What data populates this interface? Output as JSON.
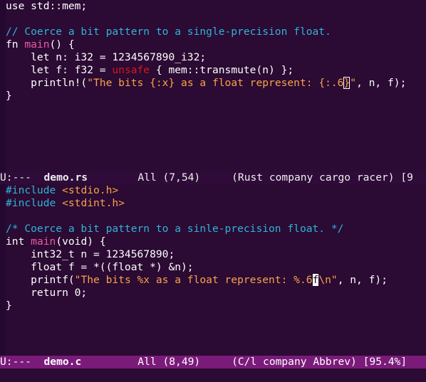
{
  "top_pane": {
    "lines": [
      [
        "use std::mem;"
      ],
      [
        ""
      ],
      [
        "// Coerce a bit pattern to a single-precision float."
      ],
      [
        "fn ",
        "main",
        "() {"
      ],
      [
        "    let n: i32 = 1234567890_i32;"
      ],
      [
        "    let f: f32 = ",
        "unsafe",
        " { mem::transmute(n) };"
      ],
      [
        "    println!(",
        "\"The bits {:x} as a float represent: {:.6",
        "}",
        "\"",
        ", n, f);"
      ],
      [
        "}"
      ]
    ],
    "modeline": {
      "status": "U:---  ",
      "buffer": "demo.rs",
      "position": "        All (7,54)     ",
      "modes": "(Rust company cargo racer) [9"
    }
  },
  "bottom_pane": {
    "lines": [
      [
        "#include",
        " ",
        "<stdio.h>"
      ],
      [
        "#include",
        " ",
        "<stdint.h>"
      ],
      [
        ""
      ],
      [
        "/* Coerce a bit pattern to a sinle-precision float. */"
      ],
      [
        "int ",
        "main",
        "(void) {"
      ],
      [
        "    int32_t n = 1234567890;"
      ],
      [
        "    float f = *((float *) &n);"
      ],
      [
        "    printf(",
        "\"The bits %x as a float represent: %.6",
        "f",
        "\\n\"",
        ", n, f);"
      ],
      [
        "    return 0;"
      ],
      [
        "}"
      ]
    ],
    "modeline": {
      "status": "U:---  ",
      "buffer": "demo.c",
      "position": "         All (8,49)     ",
      "modes": "(C/l company Abbrev) [95.4%]"
    }
  },
  "colors": {
    "background": "#2b0a33",
    "comment": "#2fb4d6",
    "function_name": "#ef5ba1",
    "string": "#f7a34a",
    "keyword_unsafe": "#d11a1a",
    "active_modeline": "#7a1b7a"
  }
}
